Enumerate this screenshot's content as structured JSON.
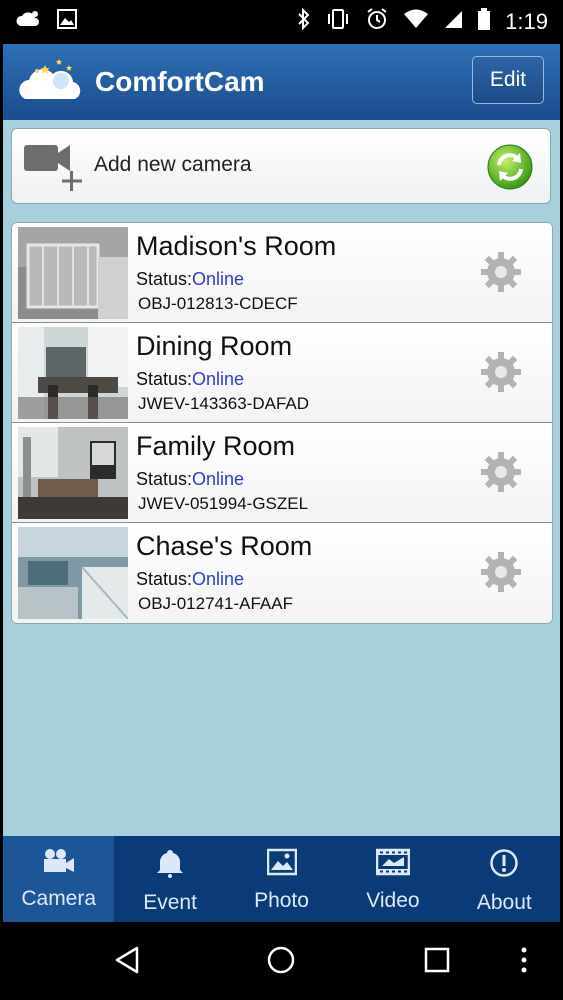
{
  "status_bar": {
    "time": "1:19",
    "left_icons": [
      "weather-cloud-icon",
      "image-icon"
    ],
    "right_icons": [
      "bluetooth-icon",
      "vibrate-icon",
      "alarm-icon",
      "wifi-icon",
      "cell-signal-icon",
      "battery-icon"
    ]
  },
  "app_bar": {
    "title": "ComfortCam",
    "edit_label": "Edit"
  },
  "add_camera": {
    "label": "Add new camera"
  },
  "cameras": [
    {
      "name": "Madison's Room",
      "status_label": "Status:",
      "status": "Online",
      "id": "OBJ-012813-CDECF"
    },
    {
      "name": "Dining Room",
      "status_label": "Status:",
      "status": "Online",
      "id": "JWEV-143363-DAFAD"
    },
    {
      "name": "Family Room",
      "status_label": "Status:",
      "status": "Online",
      "id": "JWEV-051994-GSZEL"
    },
    {
      "name": "Chase's Room",
      "status_label": "Status:",
      "status": "Online",
      "id": "OBJ-012741-AFAAF"
    }
  ],
  "tabs": [
    {
      "label": "Camera",
      "icon": "camera-icon",
      "active": true
    },
    {
      "label": "Event",
      "icon": "bell-icon",
      "active": false
    },
    {
      "label": "Photo",
      "icon": "photo-icon",
      "active": false
    },
    {
      "label": "Video",
      "icon": "film-icon",
      "active": false
    },
    {
      "label": "About",
      "icon": "info-icon",
      "active": false
    }
  ],
  "colors": {
    "background": "#a8d0dc",
    "header": "#1a4c8e",
    "tab_bar": "#0b3a78",
    "online": "#2a3fd0"
  }
}
